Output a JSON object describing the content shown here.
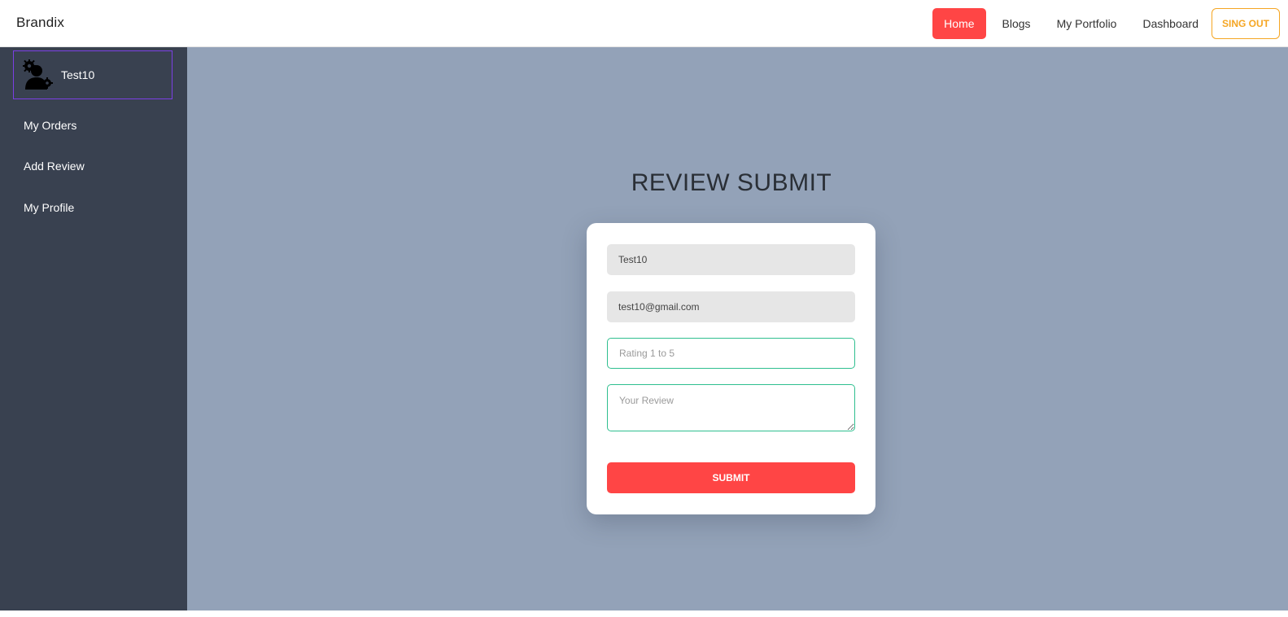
{
  "header": {
    "brand": "Brandix",
    "nav": {
      "home": "Home",
      "blogs": "Blogs",
      "portfolio": "My Portfolio",
      "dashboard": "Dashboard",
      "signout": "SING OUT"
    }
  },
  "sidebar": {
    "user": {
      "name": "Test10",
      "avatar_icon": "user-gear-icon"
    },
    "items": [
      {
        "label": "My Orders"
      },
      {
        "label": "Add Review"
      },
      {
        "label": "My Profile"
      }
    ]
  },
  "main": {
    "title": "REVIEW SUBMIT",
    "form": {
      "name_value": "Test10",
      "email_value": "test10@gmail.com",
      "rating_placeholder": "Rating 1 to 5",
      "review_placeholder": "Your Review",
      "submit_label": "SUBMIT"
    }
  },
  "colors": {
    "accent": "#ff4545",
    "signout": "#f5a623",
    "sidebar_bg": "#394150",
    "main_bg": "#93a2b8",
    "input_border": "#2fbf8f"
  }
}
